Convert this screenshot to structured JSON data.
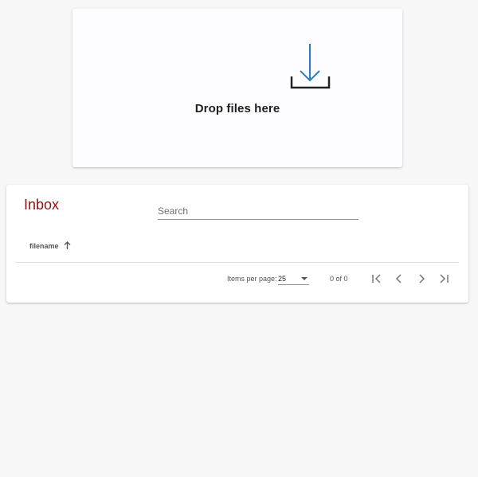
{
  "dropzone": {
    "icon": "download-icon",
    "label": "Drop files here"
  },
  "inbox": {
    "title": "Inbox",
    "search": {
      "placeholder": "Search",
      "value": ""
    },
    "columns": [
      {
        "label": "filename",
        "sort": "ascending",
        "sort_icon": "arrow-up-icon"
      }
    ],
    "rows": [],
    "paginator": {
      "items_per_page_label": "Items per page:",
      "items_per_page_value": "25",
      "range_label": "0 of 0",
      "buttons": [
        "first-page-icon",
        "previous-page-icon",
        "next-page-icon",
        "last-page-icon"
      ]
    }
  },
  "colors": {
    "title": "#8a1111",
    "download_arrow": "#2a7fc0",
    "page_background": "#f7f7f8"
  }
}
